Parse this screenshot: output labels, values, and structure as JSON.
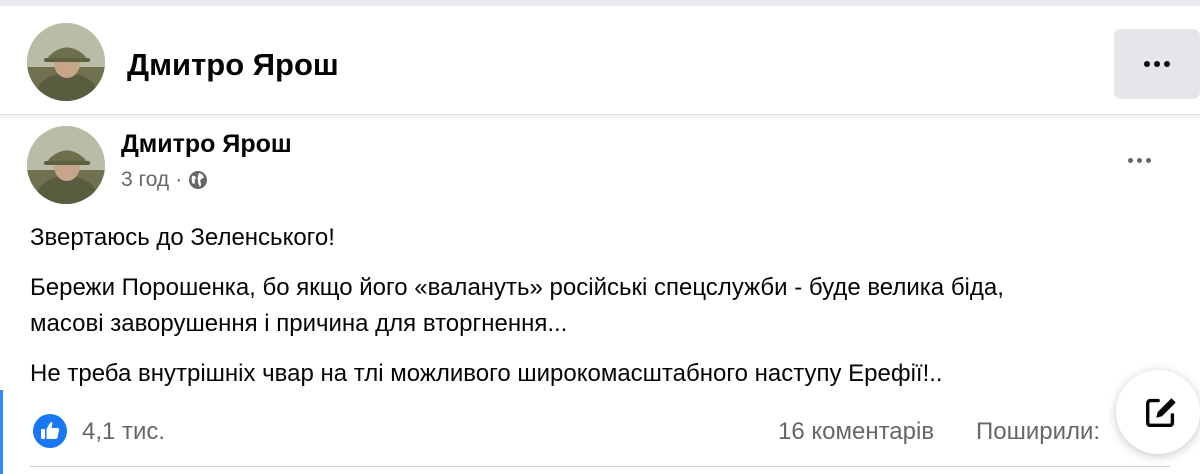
{
  "header": {
    "name": "Дмитро Ярош",
    "more_icon": "more-horizontal-icon"
  },
  "post": {
    "author": "Дмитро Ярош",
    "time": "3 год",
    "separator": "·",
    "audience_icon": "globe-icon",
    "paragraphs": [
      "Звертаюсь до Зеленського!",
      "Бережи Порошенка, бо якщо його «валануть» російські спецслужби - буде велика біда,",
      "масові заворушення і причина для вторгнення...",
      "Не треба внутрішніх чвар на тлі можливого широкомасштабного наступу  Ерефії!.."
    ],
    "reaction_icon": "like-icon",
    "likes": "4,1 тис.",
    "comments": "16 коментарів",
    "shares": "Поширили:"
  },
  "fab": {
    "icon": "compose-icon"
  },
  "colors": {
    "accent": "#1877f2",
    "background": "#f0f2f5",
    "secondary_text": "#65676b"
  }
}
